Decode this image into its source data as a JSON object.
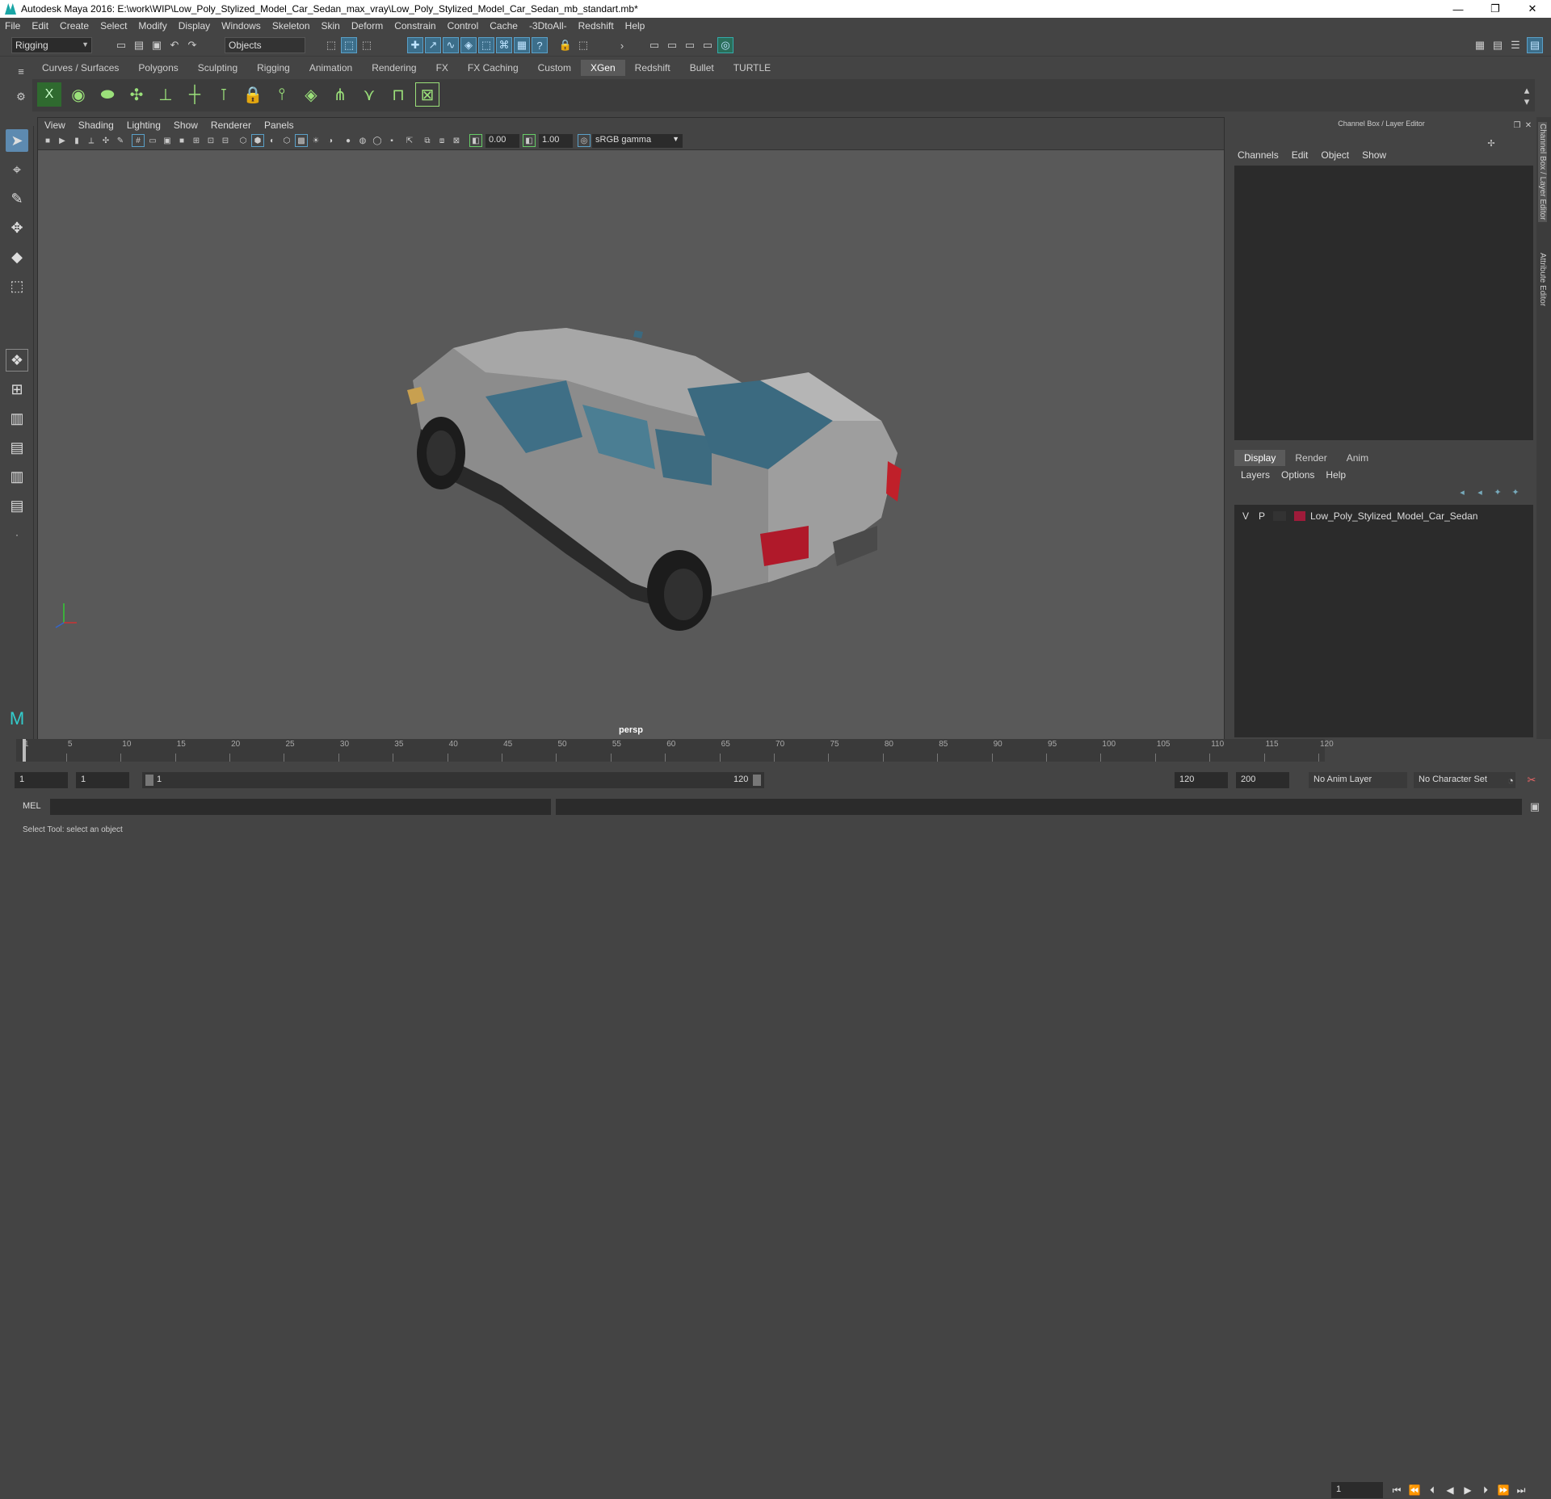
{
  "window": {
    "title": "Autodesk Maya 2016: E:\\work\\WIP\\Low_Poly_Stylized_Model_Car_Sedan_max_vray\\Low_Poly_Stylized_Model_Car_Sedan_mb_standart.mb*",
    "minimize": "—",
    "maximize": "❐",
    "close": "✕"
  },
  "menubar": [
    "File",
    "Edit",
    "Create",
    "Select",
    "Modify",
    "Display",
    "Windows",
    "Skeleton",
    "Skin",
    "Deform",
    "Constrain",
    "Control",
    "Cache",
    "-3DtoAll-",
    "Redshift",
    "Help"
  ],
  "statusline": {
    "mode": "Rigging",
    "select_mode": "Objects"
  },
  "shelf": {
    "tabs": [
      "Curves / Surfaces",
      "Polygons",
      "Sculpting",
      "Rigging",
      "Animation",
      "Rendering",
      "FX",
      "FX Caching",
      "Custom",
      "XGen",
      "Redshift",
      "Bullet",
      "TURTLE"
    ],
    "active_tab": "XGen"
  },
  "viewport": {
    "menu": [
      "View",
      "Shading",
      "Lighting",
      "Show",
      "Renderer",
      "Panels"
    ],
    "field_a": "0.00",
    "field_b": "1.00",
    "color_space": "sRGB gamma",
    "camera": "persp"
  },
  "channel_box": {
    "title": "Channel Box / Layer Editor",
    "menu": [
      "Channels",
      "Edit",
      "Object",
      "Show"
    ]
  },
  "layer_editor": {
    "tabs": [
      "Display",
      "Render",
      "Anim"
    ],
    "active_tab": "Display",
    "menu": [
      "Layers",
      "Options",
      "Help"
    ],
    "layer": {
      "v": "V",
      "p": "P",
      "name": "Low_Poly_Stylized_Model_Car_Sedan",
      "color": "#9e1b3a"
    }
  },
  "side_tabs": [
    "Channel Box / Layer Editor",
    "Attribute Editor"
  ],
  "timeline": {
    "ticks": [
      1,
      5,
      10,
      15,
      20,
      25,
      30,
      35,
      40,
      45,
      50,
      55,
      60,
      65,
      70,
      75,
      80,
      85,
      90,
      95,
      100,
      105,
      110,
      115,
      120
    ],
    "current_frame": "1"
  },
  "range": {
    "start": "1",
    "playback_start": "1",
    "slider_start": "1",
    "slider_end": "120",
    "playback_end": "120",
    "end": "200",
    "anim_layer": "No Anim Layer",
    "character_set": "No Character Set"
  },
  "mel": {
    "label": "MEL"
  },
  "help_line": "Select Tool: select an object"
}
